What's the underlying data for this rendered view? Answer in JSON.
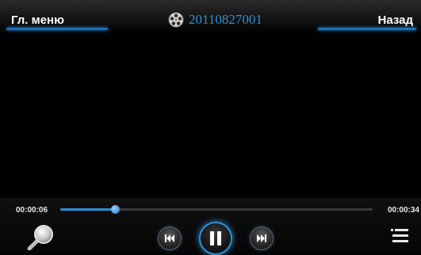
{
  "header": {
    "menu_label": "Гл. меню",
    "title": "20110827001",
    "back_label": "Назад"
  },
  "player": {
    "current_time": "00:00:06",
    "total_time": "00:00:34",
    "progress_fraction": 0.176
  },
  "icons": {
    "title": "film-reel-icon",
    "search": "magnifier-icon",
    "prev": "skip-back-icon",
    "pause": "pause-icon",
    "next": "skip-forward-icon",
    "menu": "list-menu-icon"
  },
  "colors": {
    "accent": "#2d8fd6",
    "background": "#000000"
  }
}
